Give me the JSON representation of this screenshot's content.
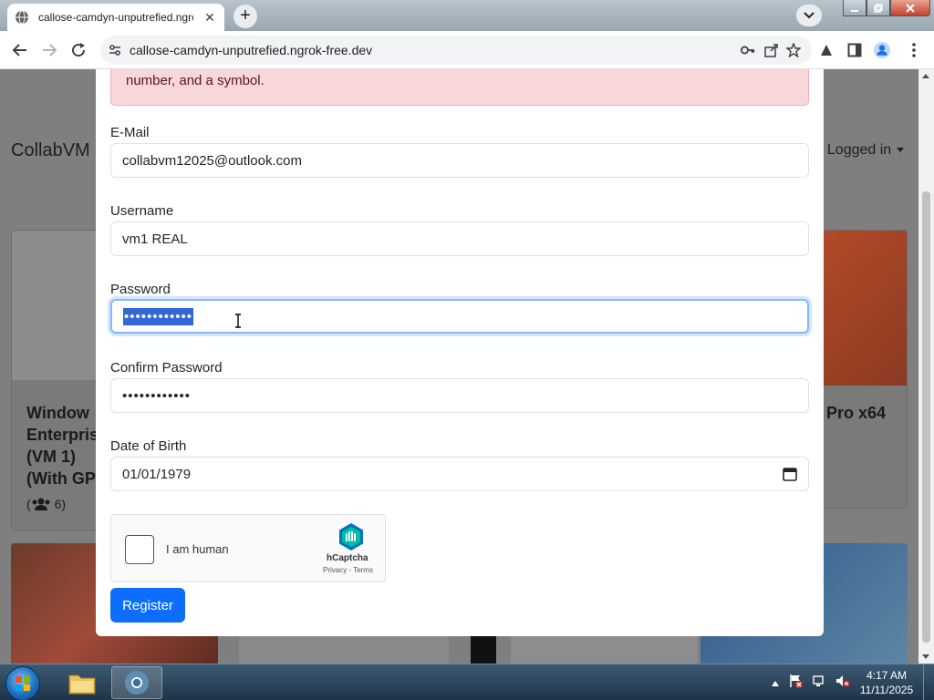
{
  "browser": {
    "tab_title": "callose-camdyn-unputrefied.ngrok-free.dev",
    "url": "callose-camdyn-unputrefied.ngrok-free.dev",
    "tab_close_glyph": "✕",
    "new_tab_glyph": "+"
  },
  "background_page": {
    "brand": "CollabVM",
    "login_text": "t Logged in",
    "card_left_title": "Window Enterpris (VM 1) (With GP",
    "card_left_count": "6)",
    "card_right_title": "Pro x64"
  },
  "modal": {
    "alert_text": "number, and a symbol.",
    "email": {
      "label": "E-Mail",
      "value": "collabvm12025@outlook.com"
    },
    "username": {
      "label": "Username",
      "value": "vm1 REAL"
    },
    "password": {
      "label": "Password",
      "value": "••••••••••••"
    },
    "confirm_password": {
      "label": "Confirm Password",
      "value": "••••••••••••"
    },
    "dob": {
      "label": "Date of Birth",
      "value": "01/01/1979"
    },
    "captcha": {
      "label": "I am human",
      "brand": "hCaptcha",
      "links": "Privacy - Terms"
    },
    "register_label": "Register"
  },
  "taskbar": {
    "time": "4:17 AM",
    "date": "11/11/2025"
  },
  "colors": {
    "primary": "#0d6efd",
    "alert_bg": "#f8d7da",
    "selection": "#3367d6"
  }
}
